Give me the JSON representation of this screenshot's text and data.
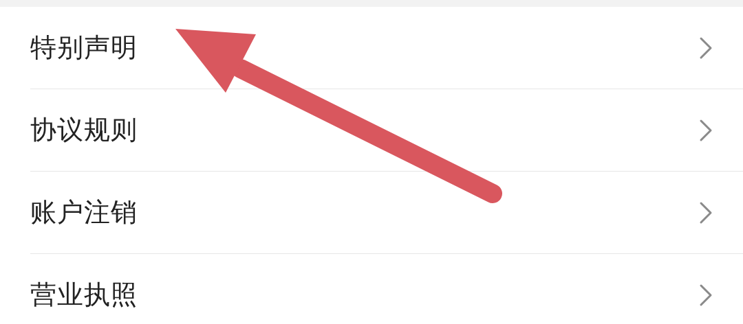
{
  "menu": {
    "items": [
      {
        "label": "特别声明"
      },
      {
        "label": "协议规则"
      },
      {
        "label": "账户注销"
      },
      {
        "label": "营业执照"
      }
    ]
  }
}
